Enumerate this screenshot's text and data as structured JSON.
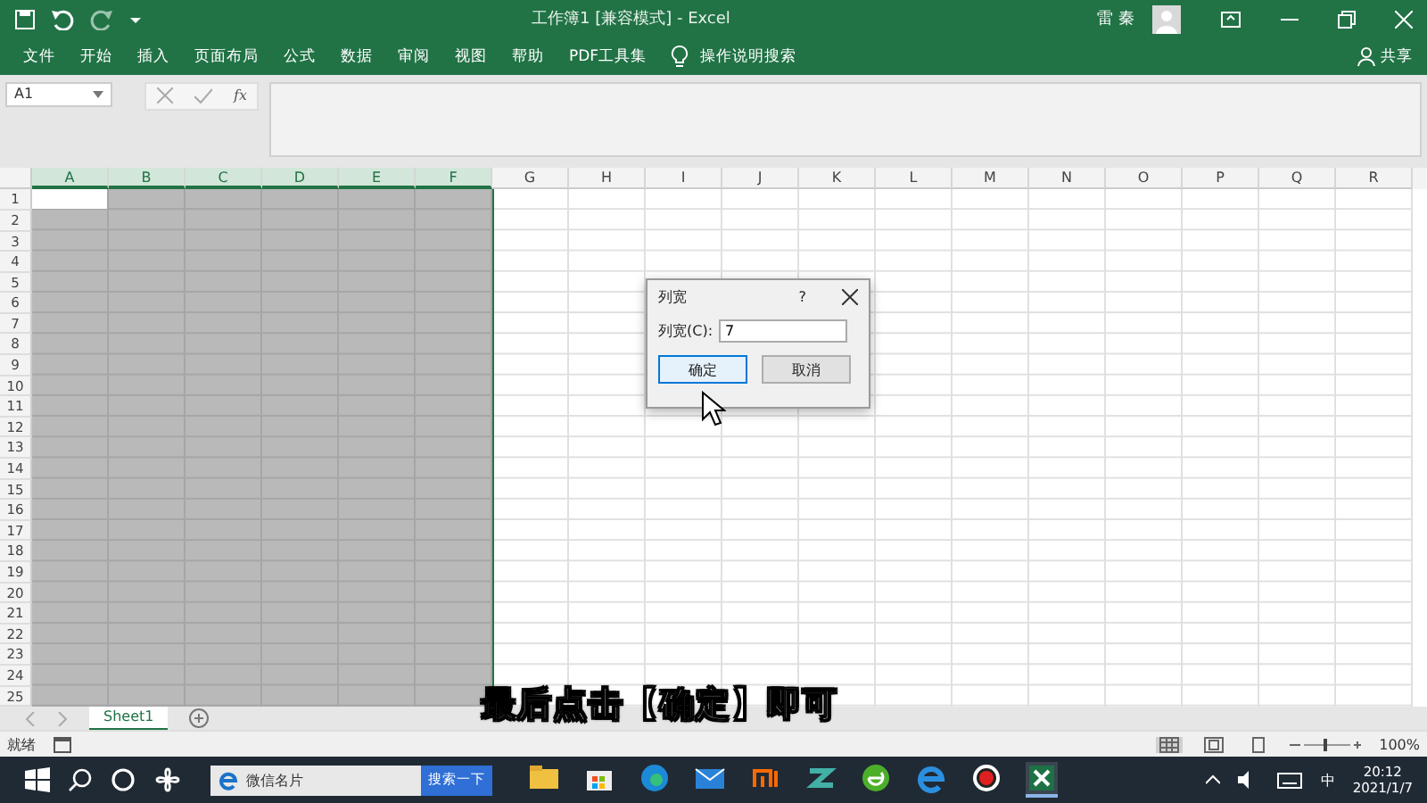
{
  "window": {
    "title": "工作簿1 [兼容模式] - Excel",
    "user": "雷 秦"
  },
  "ribbon": {
    "tabs": [
      {
        "label": "文件"
      },
      {
        "label": "开始"
      },
      {
        "label": "插入"
      },
      {
        "label": "页面布局"
      },
      {
        "label": "公式"
      },
      {
        "label": "数据"
      },
      {
        "label": "审阅"
      },
      {
        "label": "视图"
      },
      {
        "label": "帮助"
      },
      {
        "label": "PDF工具集"
      }
    ],
    "tell_me": "操作说明搜索",
    "share": "共享"
  },
  "formula_bar": {
    "name_box": "A1",
    "fx": "fx"
  },
  "grid": {
    "columns": [
      {
        "label": "A",
        "selected": true
      },
      {
        "label": "B",
        "selected": true
      },
      {
        "label": "C",
        "selected": true
      },
      {
        "label": "D",
        "selected": true
      },
      {
        "label": "E",
        "selected": true
      },
      {
        "label": "F",
        "selected": true
      },
      {
        "label": "G",
        "selected": false
      },
      {
        "label": "H",
        "selected": false
      },
      {
        "label": "I",
        "selected": false
      },
      {
        "label": "J",
        "selected": false
      },
      {
        "label": "K",
        "selected": false
      },
      {
        "label": "L",
        "selected": false
      },
      {
        "label": "M",
        "selected": false
      },
      {
        "label": "N",
        "selected": false
      },
      {
        "label": "O",
        "selected": false
      },
      {
        "label": "P",
        "selected": false
      },
      {
        "label": "Q",
        "selected": false
      },
      {
        "label": "R",
        "selected": false
      }
    ],
    "rows": [
      "1",
      "2",
      "3",
      "4",
      "5",
      "6",
      "7",
      "8",
      "9",
      "10",
      "11",
      "12",
      "13",
      "14",
      "15",
      "16",
      "17",
      "18",
      "19",
      "20",
      "21",
      "22",
      "23",
      "24",
      "25"
    ]
  },
  "dialog": {
    "title": "列宽",
    "help": "?",
    "field_label": "列宽(C):",
    "value": "7",
    "buttons": [
      {
        "label": "确定",
        "default": true
      },
      {
        "label": "取消",
        "default": false
      }
    ]
  },
  "sheet_tabs": [
    {
      "label": "Sheet1",
      "selected": true
    }
  ],
  "status_bar": {
    "status": "就绪",
    "zoom": "100%"
  },
  "caption": "最后点击【确定】即可",
  "taskbar": {
    "search_value": "微信名片",
    "search_button": "搜索一下",
    "ime": "中",
    "time": "20:12",
    "date": "2021/1/7"
  }
}
